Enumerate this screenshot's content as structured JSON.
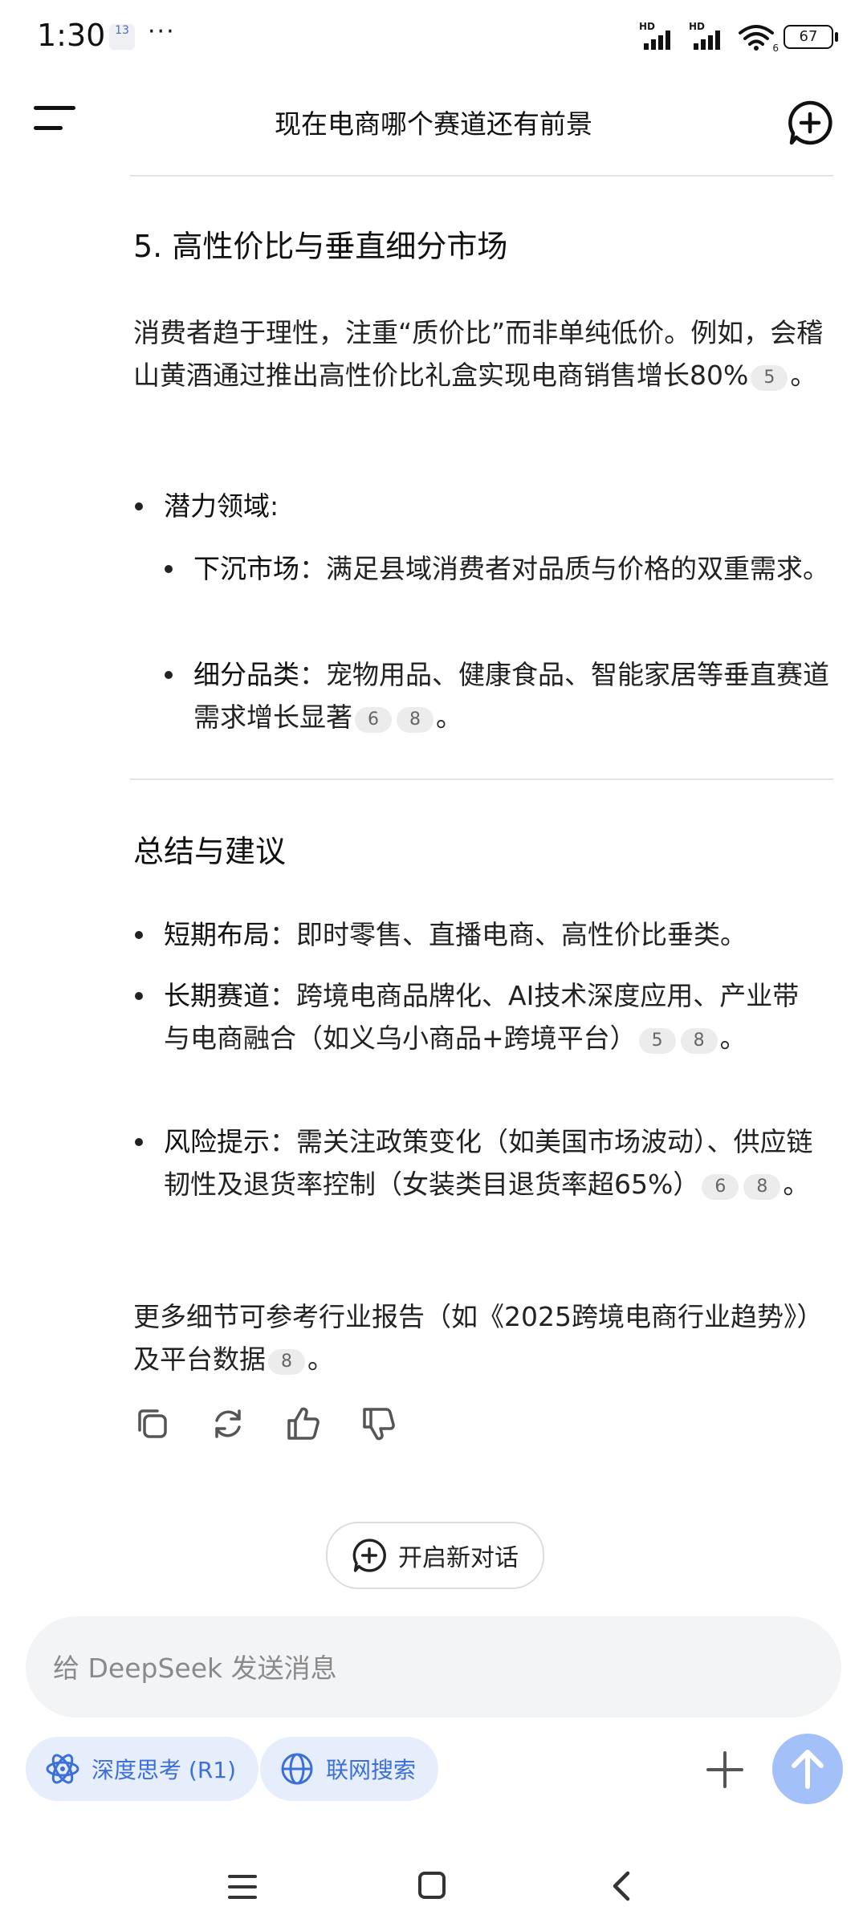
{
  "status": {
    "time": "1:30",
    "calendar": "13",
    "dots": "···",
    "signal1": "HD",
    "signal2": "HD",
    "wifi_badge": "6",
    "battery": "67"
  },
  "header": {
    "title": "现在电商哪个赛道还有前景"
  },
  "section5": {
    "heading": "5. 高性价比与垂直细分市场",
    "para_text": "消费者趋于理性，注重“质价比”而非单纯低价。例如，会稽山黄酒通过推出高性价比礼盒实现电商销售增长80%",
    "para_cite": "5",
    "para_end": "。",
    "bullet_label": "潜力领域",
    "bullet_colon": ":",
    "sub1_label": "下沉市场",
    "sub1_text": "：满足县域消费者对品质与价格的双重需求。",
    "sub2_label": "细分品类",
    "sub2_text": "：宠物用品、健康食品、智能家居等垂直赛道需求增长显著",
    "sub2_cite1": "6",
    "sub2_cite2": "8",
    "sub2_end": "。"
  },
  "summary": {
    "heading": "总结与建议",
    "b1_label": "短期布局",
    "b1_text": "：即时零售、直播电商、高性价比垂类。",
    "b2_label": "长期赛道",
    "b2_text": "：跨境电商品牌化、AI技术深度应用、产业带与电商融合（如义乌小商品+跨境平台）",
    "b2_cite1": "5",
    "b2_cite2": "8",
    "b2_end": "。",
    "b3_label": "风险提示",
    "b3_text": "：需关注政策变化（如美国市场波动）、供应链韧性及退货率控制（女装类目退货率超65%）",
    "b3_cite1": "6",
    "b3_cite2": "8",
    "b3_end": "。",
    "closing_text": "更多细节可参考行业报告（如《2025跨境电商行业趋势》）及平台数据",
    "closing_cite": "8",
    "closing_end": "。"
  },
  "actions": {
    "icons": [
      "copy-icon",
      "regenerate-icon",
      "thumbs-up-icon",
      "thumbs-down-icon"
    ]
  },
  "new_chat": {
    "label": "开启新对话"
  },
  "composer": {
    "placeholder": "给 DeepSeek 发送消息"
  },
  "chips": {
    "deep_think": "深度思考 (R1)",
    "web_search": "联网搜索"
  },
  "colors": {
    "accent": "#3d6fd8",
    "chip_bg": "#e6eefc",
    "send_bg": "#a3c1f8"
  }
}
